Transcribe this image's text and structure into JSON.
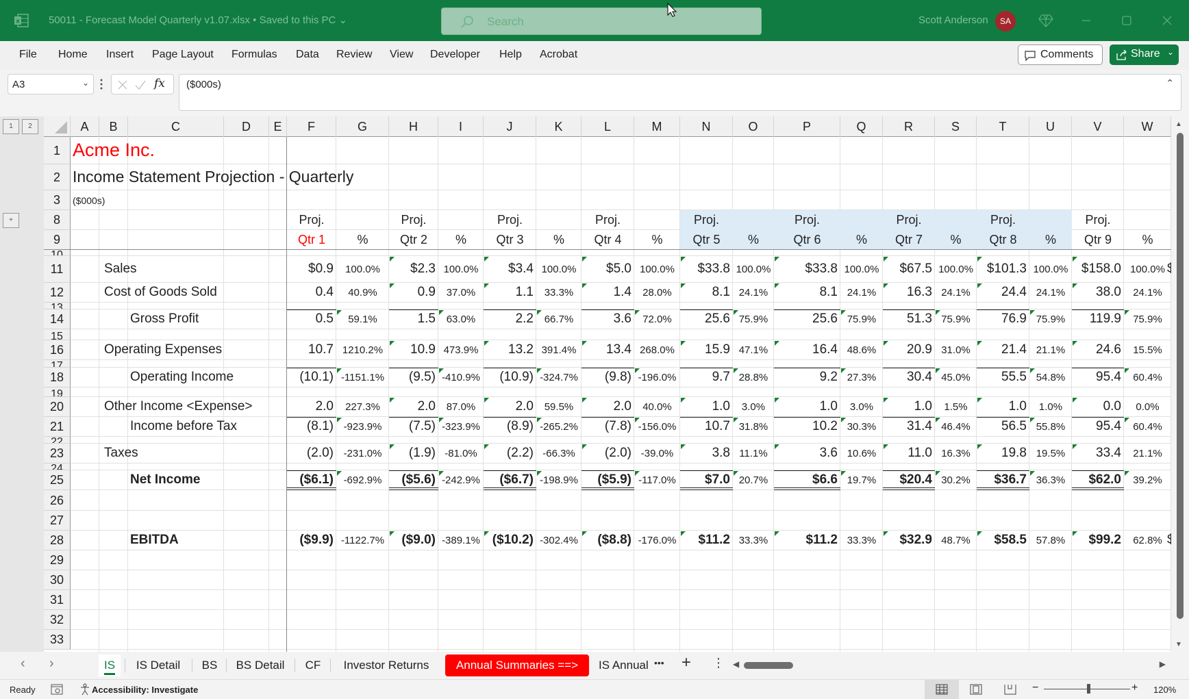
{
  "titlebar": {
    "doc_title": "50011 - Forecast Model Quarterly v1.07.xlsx • Saved to this PC ⌄",
    "search_placeholder": "Search",
    "user_name": "Scott Anderson",
    "user_initials": "SA",
    "icons": [
      "excel-icon",
      "search-icon",
      "premium-diamond-icon",
      "minimize-icon",
      "maximize-icon",
      "close-icon"
    ]
  },
  "menu": {
    "items": [
      "File",
      "Home",
      "Insert",
      "Page Layout",
      "Formulas",
      "Data",
      "Review",
      "View",
      "Developer",
      "Help",
      "Acrobat"
    ],
    "comments_label": "Comments",
    "share_label": "Share"
  },
  "formula_bar": {
    "name_box": "A3",
    "formula": "($000s)",
    "fx_label": "fx"
  },
  "outline": {
    "levels": [
      "1",
      "2"
    ],
    "expand": "+"
  },
  "columns": [
    "A",
    "B",
    "C",
    "D",
    "E",
    "F",
    "G",
    "H",
    "I",
    "J",
    "K",
    "L",
    "M",
    "N",
    "O",
    "P",
    "Q",
    "R",
    "S",
    "T",
    "U",
    "V",
    "W"
  ],
  "rows_visible": [
    "1",
    "2",
    "3",
    "8",
    "9",
    "10",
    "11",
    "12",
    "13",
    "14",
    "15",
    "16",
    "17",
    "18",
    "19",
    "20",
    "21",
    "22",
    "23",
    "24",
    "25",
    "26",
    "27",
    "28",
    "29",
    "30",
    "31",
    "32",
    "33"
  ],
  "sheet": {
    "company": "Acme Inc.",
    "title": "Income Statement Projection - Quarterly",
    "units": "($000s)",
    "header_top": "Proj.",
    "quarters": [
      "Qtr 1",
      "Qtr 2",
      "Qtr 3",
      "Qtr 4",
      "Qtr 5",
      "Qtr 6",
      "Qtr 7",
      "Qtr 8",
      "Qtr 9"
    ],
    "pct_header": "%",
    "highlight_color": "#ddebf7",
    "accent_red": "#ff0000",
    "lines": [
      {
        "label": "Sales",
        "values": [
          "$0.9",
          "$2.3",
          "$3.4",
          "$5.0",
          "$33.8",
          "$33.8",
          "$67.5",
          "$101.3",
          "$158.0"
        ],
        "pcts": [
          "100.0%",
          "100.0%",
          "100.0%",
          "100.0%",
          "100.0%",
          "100.0%",
          "100.0%",
          "100.0%",
          "100.0%"
        ]
      },
      {
        "label": "Cost of Goods Sold",
        "values": [
          "0.4",
          "0.9",
          "1.1",
          "1.4",
          "8.1",
          "8.1",
          "16.3",
          "24.4",
          "38.0"
        ],
        "pcts": [
          "40.9%",
          "37.0%",
          "33.3%",
          "28.0%",
          "24.1%",
          "24.1%",
          "24.1%",
          "24.1%",
          "24.1%"
        ]
      },
      {
        "label": "Gross Profit",
        "values": [
          "0.5",
          "1.5",
          "2.2",
          "3.6",
          "25.6",
          "25.6",
          "51.3",
          "76.9",
          "119.9"
        ],
        "pcts": [
          "59.1%",
          "63.0%",
          "66.7%",
          "72.0%",
          "75.9%",
          "75.9%",
          "75.9%",
          "75.9%",
          "75.9%"
        ]
      },
      {
        "label": "Operating Expenses",
        "values": [
          "10.7",
          "10.9",
          "13.2",
          "13.4",
          "15.9",
          "16.4",
          "20.9",
          "21.4",
          "24.6"
        ],
        "pcts": [
          "1210.2%",
          "473.9%",
          "391.4%",
          "268.0%",
          "47.1%",
          "48.6%",
          "31.0%",
          "21.1%",
          "15.5%"
        ]
      },
      {
        "label": "Operating Income",
        "values": [
          "(10.1)",
          "(9.5)",
          "(10.9)",
          "(9.8)",
          "9.7",
          "9.2",
          "30.4",
          "55.5",
          "95.4"
        ],
        "pcts": [
          "-1151.1%",
          "-410.9%",
          "-324.7%",
          "-196.0%",
          "28.8%",
          "27.3%",
          "45.0%",
          "54.8%",
          "60.4%"
        ]
      },
      {
        "label": "Other Income <Expense>",
        "values": [
          "2.0",
          "2.0",
          "2.0",
          "2.0",
          "1.0",
          "1.0",
          "1.0",
          "1.0",
          "0.0"
        ],
        "pcts": [
          "227.3%",
          "87.0%",
          "59.5%",
          "40.0%",
          "3.0%",
          "3.0%",
          "1.5%",
          "1.0%",
          "0.0%"
        ]
      },
      {
        "label": "Income before Tax",
        "values": [
          "(8.1)",
          "(7.5)",
          "(8.9)",
          "(7.8)",
          "10.7",
          "10.2",
          "31.4",
          "56.5",
          "95.4"
        ],
        "pcts": [
          "-923.9%",
          "-323.9%",
          "-265.2%",
          "-156.0%",
          "31.8%",
          "30.3%",
          "46.4%",
          "55.8%",
          "60.4%"
        ]
      },
      {
        "label": "Taxes",
        "values": [
          "(2.0)",
          "(1.9)",
          "(2.2)",
          "(2.0)",
          "3.8",
          "3.6",
          "11.0",
          "19.8",
          "33.4"
        ],
        "pcts": [
          "-231.0%",
          "-81.0%",
          "-66.3%",
          "-39.0%",
          "11.1%",
          "10.6%",
          "16.3%",
          "19.5%",
          "21.1%"
        ]
      },
      {
        "label": "Net Income",
        "values": [
          "($6.1)",
          "($5.6)",
          "($6.7)",
          "($5.9)",
          "$7.0",
          "$6.6",
          "$20.4",
          "$36.7",
          "$62.0"
        ],
        "pcts": [
          "-692.9%",
          "-242.9%",
          "-198.9%",
          "-117.0%",
          "20.7%",
          "19.7%",
          "30.2%",
          "36.3%",
          "39.2%"
        ]
      },
      {
        "label": "EBITDA",
        "values": [
          "($9.9)",
          "($9.0)",
          "($10.2)",
          "($8.8)",
          "$11.2",
          "$11.2",
          "$32.9",
          "$58.5",
          "$99.2"
        ],
        "pcts": [
          "-1122.7%",
          "-389.1%",
          "-302.4%",
          "-176.0%",
          "33.3%",
          "33.3%",
          "48.7%",
          "57.8%",
          "62.8%"
        ]
      }
    ],
    "w_overflow": "$"
  },
  "tabs": {
    "items": [
      {
        "label": "IS",
        "active": true
      },
      {
        "label": "IS Detail"
      },
      {
        "label": "BS"
      },
      {
        "label": "BS Detail"
      },
      {
        "label": "CF"
      },
      {
        "label": "Investor Returns"
      },
      {
        "label": "Annual Summaries ==>",
        "color": "#ff0000"
      },
      {
        "label": "IS Annual"
      }
    ],
    "more": "•••",
    "add": "+",
    "options": "⋮"
  },
  "status": {
    "ready": "Ready",
    "accessibility": "Accessibility: Investigate",
    "zoom": "120%",
    "zoom_minus": "−",
    "zoom_plus": "+",
    "zoom_percent_value": 120
  }
}
